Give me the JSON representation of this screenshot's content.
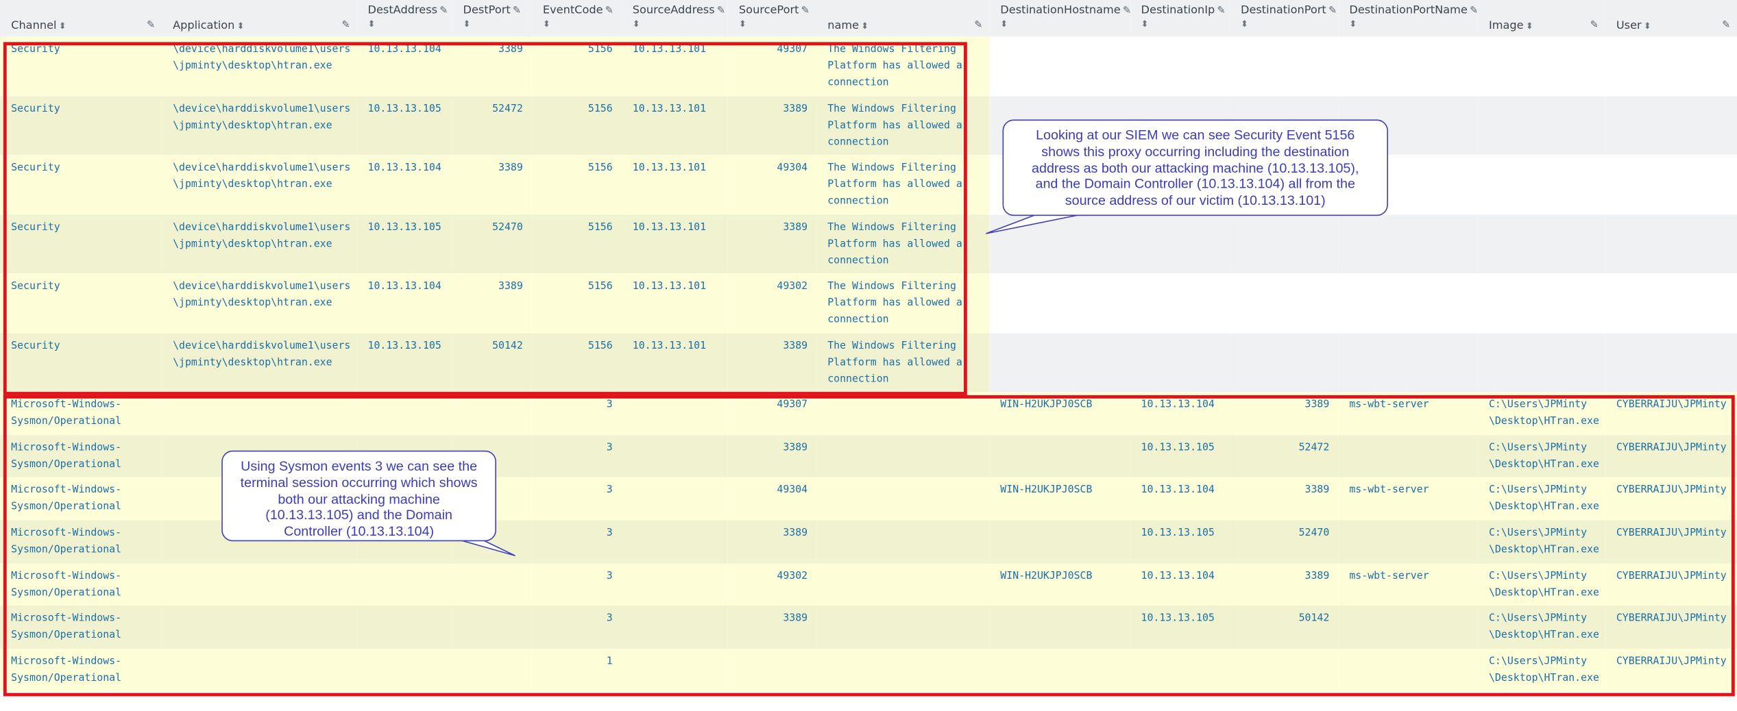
{
  "columns": {
    "channel": "Channel",
    "application": "Application",
    "dest_address": "DestAddress",
    "dest_port": "DestPort",
    "event_code": "EventCode",
    "source_address": "SourceAddress",
    "source_port": "SourcePort",
    "name": "name",
    "destination_hostname": "DestinationHostname",
    "destination_ip": "DestinationIp",
    "destination_port": "DestinationPort",
    "destination_port_name": "DestinationPortName",
    "image": "Image",
    "user": "User"
  },
  "security_rows": [
    {
      "channel": "Security",
      "app1": "\\device\\harddiskvolume1\\users",
      "app2": "\\jpminty\\desktop\\htran.exe",
      "dest_address": "10.13.13.104",
      "dest_port": "3389",
      "event_code": "5156",
      "source_address": "10.13.13.101",
      "source_port": "49307",
      "name1": "The Windows Filtering",
      "name2": "Platform has allowed a",
      "name3": "connection"
    },
    {
      "channel": "Security",
      "app1": "\\device\\harddiskvolume1\\users",
      "app2": "\\jpminty\\desktop\\htran.exe",
      "dest_address": "10.13.13.105",
      "dest_port": "52472",
      "event_code": "5156",
      "source_address": "10.13.13.101",
      "source_port": "3389",
      "name1": "The Windows Filtering",
      "name2": "Platform has allowed a",
      "name3": "connection"
    },
    {
      "channel": "Security",
      "app1": "\\device\\harddiskvolume1\\users",
      "app2": "\\jpminty\\desktop\\htran.exe",
      "dest_address": "10.13.13.104",
      "dest_port": "3389",
      "event_code": "5156",
      "source_address": "10.13.13.101",
      "source_port": "49304",
      "name1": "The Windows Filtering",
      "name2": "Platform has allowed a",
      "name3": "connection"
    },
    {
      "channel": "Security",
      "app1": "\\device\\harddiskvolume1\\users",
      "app2": "\\jpminty\\desktop\\htran.exe",
      "dest_address": "10.13.13.105",
      "dest_port": "52470",
      "event_code": "5156",
      "source_address": "10.13.13.101",
      "source_port": "3389",
      "name1": "The Windows Filtering",
      "name2": "Platform has allowed a",
      "name3": "connection"
    },
    {
      "channel": "Security",
      "app1": "\\device\\harddiskvolume1\\users",
      "app2": "\\jpminty\\desktop\\htran.exe",
      "dest_address": "10.13.13.104",
      "dest_port": "3389",
      "event_code": "5156",
      "source_address": "10.13.13.101",
      "source_port": "49302",
      "name1": "The Windows Filtering",
      "name2": "Platform has allowed a",
      "name3": "connection"
    },
    {
      "channel": "Security",
      "app1": "\\device\\harddiskvolume1\\users",
      "app2": "\\jpminty\\desktop\\htran.exe",
      "dest_address": "10.13.13.105",
      "dest_port": "50142",
      "event_code": "5156",
      "source_address": "10.13.13.101",
      "source_port": "3389",
      "name1": "The Windows Filtering",
      "name2": "Platform has allowed a",
      "name3": "connection"
    }
  ],
  "sysmon_rows": [
    {
      "channel1": "Microsoft-Windows-",
      "channel2": "Sysmon/Operational",
      "event_code": "3",
      "source_port": "49307",
      "destination_hostname": "WIN-H2UKJPJ0SCB",
      "destination_ip": "10.13.13.104",
      "destination_port": "3389",
      "destination_port_name": "ms-wbt-server",
      "image1": "C:\\Users\\JPMinty",
      "image2": "\\Desktop\\HTran.exe",
      "user": "CYBERRAIJU\\JPMinty"
    },
    {
      "channel1": "Microsoft-Windows-",
      "channel2": "Sysmon/Operational",
      "event_code": "3",
      "source_port": "3389",
      "destination_hostname": "",
      "destination_ip": "10.13.13.105",
      "destination_port": "52472",
      "destination_port_name": "",
      "image1": "C:\\Users\\JPMinty",
      "image2": "\\Desktop\\HTran.exe",
      "user": "CYBERRAIJU\\JPMinty"
    },
    {
      "channel1": "Microsoft-Windows-",
      "channel2": "Sysmon/Operational",
      "event_code": "3",
      "source_port": "49304",
      "destination_hostname": "WIN-H2UKJPJ0SCB",
      "destination_ip": "10.13.13.104",
      "destination_port": "3389",
      "destination_port_name": "ms-wbt-server",
      "image1": "C:\\Users\\JPMinty",
      "image2": "\\Desktop\\HTran.exe",
      "user": "CYBERRAIJU\\JPMinty"
    },
    {
      "channel1": "Microsoft-Windows-",
      "channel2": "Sysmon/Operational",
      "event_code": "3",
      "source_port": "3389",
      "destination_hostname": "",
      "destination_ip": "10.13.13.105",
      "destination_port": "52470",
      "destination_port_name": "",
      "image1": "C:\\Users\\JPMinty",
      "image2": "\\Desktop\\HTran.exe",
      "user": "CYBERRAIJU\\JPMinty"
    },
    {
      "channel1": "Microsoft-Windows-",
      "channel2": "Sysmon/Operational",
      "event_code": "3",
      "source_port": "49302",
      "destination_hostname": "WIN-H2UKJPJ0SCB",
      "destination_ip": "10.13.13.104",
      "destination_port": "3389",
      "destination_port_name": "ms-wbt-server",
      "image1": "C:\\Users\\JPMinty",
      "image2": "\\Desktop\\HTran.exe",
      "user": "CYBERRAIJU\\JPMinty"
    },
    {
      "channel1": "Microsoft-Windows-",
      "channel2": "Sysmon/Operational",
      "event_code": "3",
      "source_port": "3389",
      "destination_hostname": "",
      "destination_ip": "10.13.13.105",
      "destination_port": "50142",
      "destination_port_name": "",
      "image1": "C:\\Users\\JPMinty",
      "image2": "\\Desktop\\HTran.exe",
      "user": "CYBERRAIJU\\JPMinty"
    },
    {
      "channel1": "Microsoft-Windows-",
      "channel2": "Sysmon/Operational",
      "event_code": "1",
      "source_port": "",
      "destination_hostname": "",
      "destination_ip": "",
      "destination_port": "",
      "destination_port_name": "",
      "image1": "C:\\Users\\JPMinty",
      "image2": "\\Desktop\\HTran.exe",
      "user": "CYBERRAIJU\\JPMinty"
    }
  ],
  "callouts": {
    "siem": {
      "line1": "Looking at our SIEM we can see Security Event 5156",
      "line2": "shows this proxy occurring including the destination",
      "line3": "address as both our attacking machine (10.13.13.105),",
      "line4": "and the Domain Controller (10.13.13.104) all from the",
      "line5": "source address of our victim (10.13.13.101)"
    },
    "sysmon": {
      "line1": "Using Sysmon events 3 we can see the",
      "line2": "terminal session occurring which shows",
      "line3": "both our attacking machine",
      "line4": "(10.13.13.105) and the Domain",
      "line5": "Controller (10.13.13.104)"
    }
  },
  "icons": {
    "sort": "sort-arrows-icon",
    "edit": "pencil-icon"
  },
  "colors": {
    "highlight_border": "#e0131b",
    "cell_text": "#1a6fa8",
    "callout_text": "#3b3bbf",
    "row_yellow": "#fdfdd8",
    "row_yellow_alt": "#f1f3d0"
  }
}
